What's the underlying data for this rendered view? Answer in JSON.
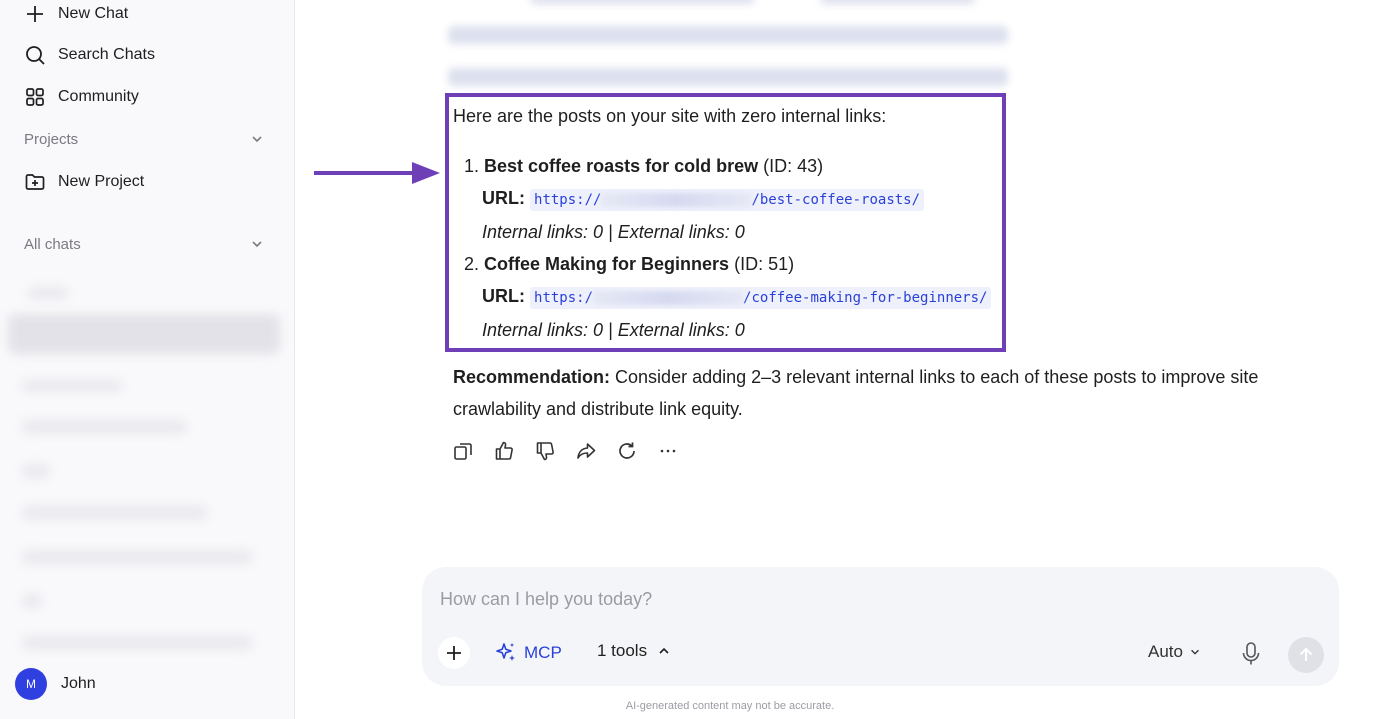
{
  "sidebar": {
    "new_chat": "New Chat",
    "search_chats": "Search Chats",
    "community": "Community",
    "projects_label": "Projects",
    "new_project": "New Project",
    "all_chats_label": "All chats",
    "user": {
      "initial": "M",
      "name": "John"
    }
  },
  "message": {
    "intro": "Here are the posts on your site with zero internal links:",
    "posts": [
      {
        "number": "1.",
        "title": "Best coffee roasts for cold brew",
        "id_text": "(ID: 43)",
        "url_label": "URL:",
        "url_prefix": "https://",
        "url_suffix": "/best-coffee-roasts/",
        "links": "Internal links: 0 | External links: 0"
      },
      {
        "number": "2.",
        "title": "Coffee Making for Beginners",
        "id_text": "(ID: 51)",
        "url_label": "URL:",
        "url_prefix": "https:/",
        "url_suffix": "/coffee-making-for-beginners/",
        "links": "Internal links: 0 | External links: 0"
      }
    ],
    "recommendation_label": "Recommendation:",
    "recommendation_text": " Consider adding 2–3 relevant internal links to each of these posts to improve site crawlability and distribute link equity."
  },
  "actions": [
    "copy-icon",
    "thumbs-up-icon",
    "thumbs-down-icon",
    "share-icon",
    "regenerate-icon",
    "more-icon"
  ],
  "composer": {
    "placeholder": "How can I help you today?",
    "mcp_label": "MCP",
    "tools_label": "1 tools",
    "model_label": "Auto"
  },
  "disclaimer": "AI-generated content may not be accurate.",
  "colors": {
    "accent": "#2a41d8",
    "highlight_border": "#6f3fb8",
    "avatar": "#2f3fe0"
  }
}
